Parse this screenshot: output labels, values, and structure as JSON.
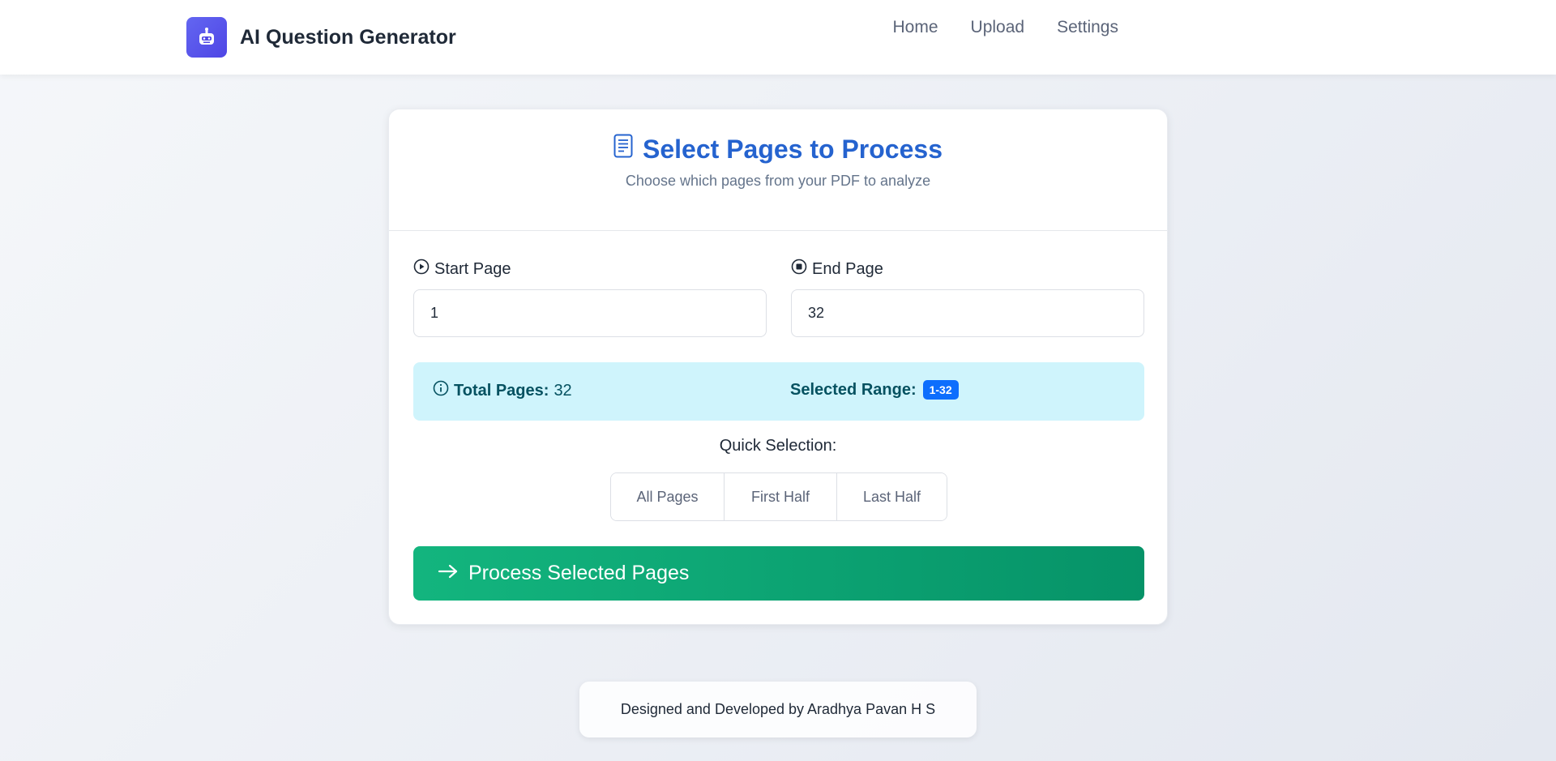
{
  "app": {
    "title": "AI Question Generator",
    "accent_color": "#4f46e5",
    "logo_icon": "robot-icon"
  },
  "nav": {
    "items": [
      {
        "label": "Home"
      },
      {
        "label": "Upload"
      },
      {
        "label": "Settings"
      }
    ]
  },
  "card": {
    "title": "Select Pages to Process",
    "title_icon": "document-icon",
    "subtitle": "Choose which pages from your PDF to analyze"
  },
  "start_page": {
    "label": "Start Page",
    "icon": "play-circle-icon",
    "value": "1"
  },
  "end_page": {
    "label": "End Page",
    "icon": "stop-circle-icon",
    "value": "32"
  },
  "info": {
    "total_label": "Total Pages:",
    "total_value": "32",
    "range_label": "Selected Range:",
    "range_value": "1-32",
    "icon": "info-icon"
  },
  "quick": {
    "label": "Quick Selection:",
    "buttons": [
      {
        "label": "All Pages"
      },
      {
        "label": "First Half"
      },
      {
        "label": "Last Half"
      }
    ]
  },
  "process": {
    "label": "Process Selected Pages",
    "icon": "arrow-right-icon",
    "color": "#10b981"
  },
  "footer": {
    "text": "Designed and Developed by Aradhya Pavan H S"
  }
}
